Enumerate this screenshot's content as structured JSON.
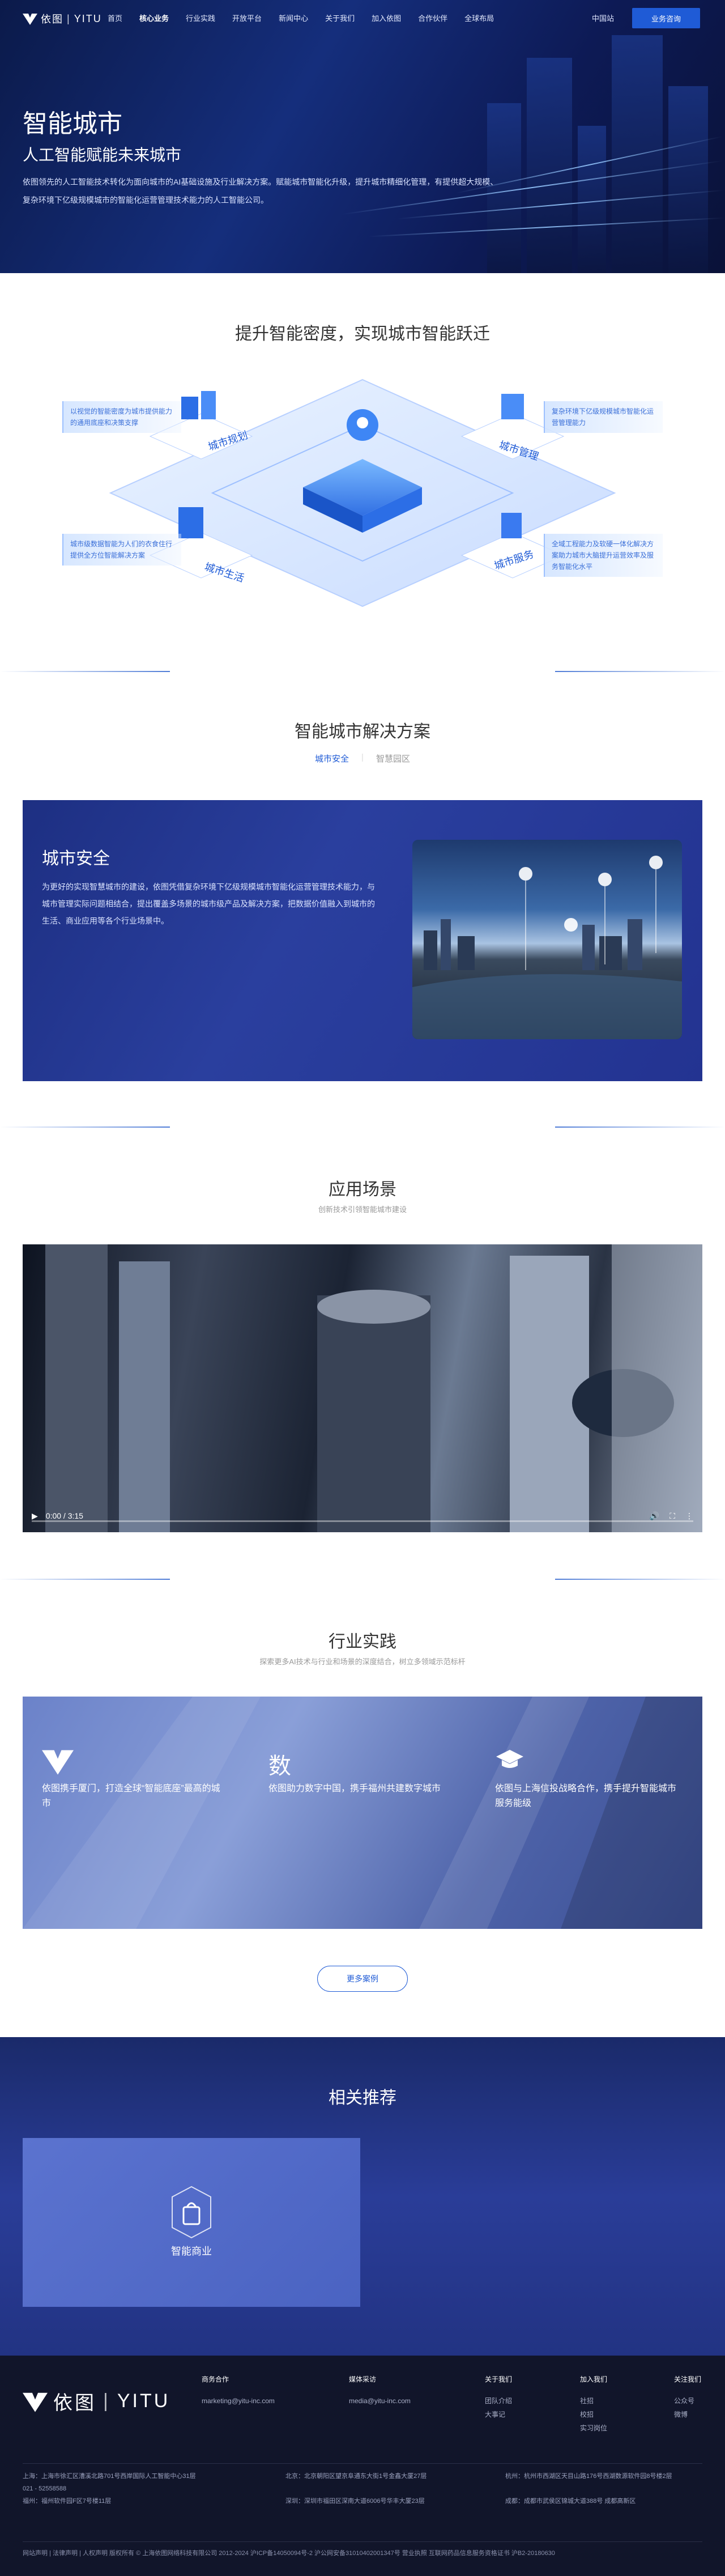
{
  "nav": {
    "brand_cn": "依图",
    "brand_en": "YITU",
    "items": [
      "首页",
      "核心业务",
      "行业实践",
      "开放平台",
      "新闻中心",
      "关于我们",
      "加入依图",
      "合作伙伴",
      "全球布局"
    ],
    "language": "中国站",
    "join_button": "业务咨询"
  },
  "hero": {
    "title": "智能城市",
    "subtitle": "人工智能赋能未来城市",
    "description": "依图领先的人工智能技术转化为面向城市的AI基础设施及行业解决方案。赋能城市智能化升级，提升城市精细化管理，有提供超大规模、复杂环境下亿级规模城市的智能化运营管理技术能力的人工智能公司。"
  },
  "density": {
    "title": "提升智能密度，实现城市智能跃迁",
    "modules": [
      "城市规划",
      "城市管理",
      "城市生活",
      "城市服务"
    ],
    "tips": [
      "以视觉的智能密度为城市提供能力的通用底座和决策支撑",
      "复杂环境下亿级规模城市智能化运营管理能力",
      "城市级数据智能为人们的衣食住行提供全方位智能解决方案",
      "全域工程能力及软硬一体化解决方案助力城市大脑提升运营效率及服务智能化水平"
    ]
  },
  "solutions": {
    "title": "智能城市解决方案",
    "tabs": [
      "城市安全",
      "智慧园区"
    ],
    "active": {
      "title": "城市安全",
      "description": "为更好的实现智慧城市的建设，依图凭借复杂环境下亿级规模城市智能化运营管理技术能力，与城市管理实际问题相结合，提出覆盖多场景的城市级产品及解决方案，把数据价值融入到城市的生活、商业应用等各个行业场景中。"
    }
  },
  "scenes": {
    "title": "应用场景",
    "subtitle": "创新技术引领智能城市建设",
    "video_time": "0:00 / 3:15"
  },
  "practice": {
    "title": "行业实践",
    "subtitle": "探索更多AI技术与行业和场景的深度结合，树立多领域示范标杆",
    "cards": [
      {
        "icon": "yitu-logo-icon",
        "text": "依图携手厦门，打造全球“智能底座”最高的城市"
      },
      {
        "icon": "calligraphy-icon",
        "text": "依图助力数字中国，携手福州共建数字城市"
      },
      {
        "icon": "graduation-cap-icon",
        "text": "依图与上海信投战略合作，携手提升智能城市服务能级"
      }
    ],
    "more": "更多案例"
  },
  "recommend": {
    "title": "相关推荐",
    "card_label": "智能商业"
  },
  "footer": {
    "brand_cn": "依图",
    "brand_en": "YITU",
    "cols": [
      {
        "head": "商务合作",
        "items": [
          "marketing@yitu-inc.com"
        ]
      },
      {
        "head": "媒体采访",
        "items": [
          "media@yitu-inc.com"
        ]
      },
      {
        "head": "关于我们",
        "items": [
          "团队介绍",
          "大事记"
        ]
      },
      {
        "head": "加入我们",
        "items": [
          "社招",
          "校招",
          "实习岗位"
        ]
      },
      {
        "head": "关注我们",
        "items": [
          "公众号",
          "微博"
        ]
      }
    ],
    "addresses": [
      "上海：上海市徐汇区漕溪北路701号西岸国际人工智能中心31层",
      "021 - 52558588",
      "福州：福州软件园F区7号楼11层",
      "北京：北京朝阳区望京阜通东大街1号金鑫大厦27层",
      "深圳：深圳市福田区深南大道6006号华丰大厦23层",
      "杭州：杭州市西湖区天目山路176号西湖数源软件园8号楼2层",
      "成都：成都市武侯区锦城大道388号 成都高新区"
    ],
    "copyright": "网站声明 | 法律声明 | 人权声明  版权所有 © 上海依图网络科技有限公司 2012-2024  沪ICP备14050094号-2  沪公网安备31010402001347号  营业执照  互联网药品信息服务资格证书 沪B2-20180630"
  }
}
